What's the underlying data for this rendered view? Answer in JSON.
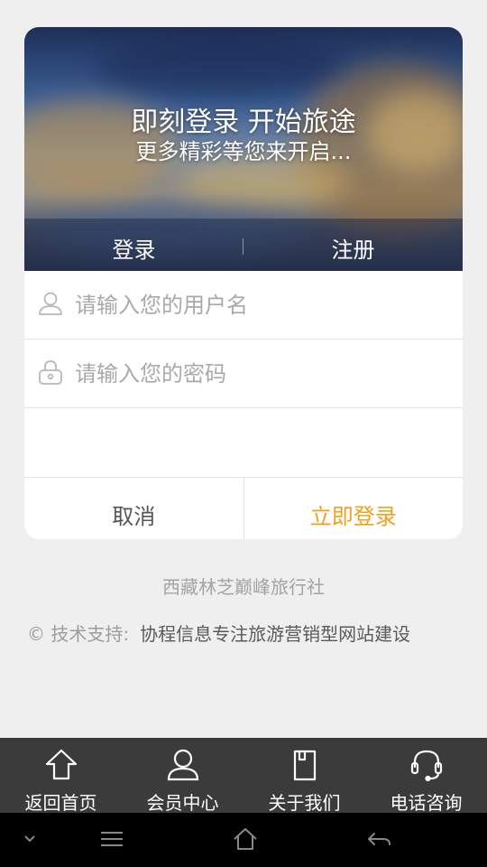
{
  "hero": {
    "title": "即刻登录 开始旅途",
    "subtitle": "更多精彩等您来开启..."
  },
  "tabs": {
    "login": "登录",
    "register": "注册"
  },
  "form": {
    "username_placeholder": "请输入您的用户名",
    "password_placeholder": "请输入您的密码",
    "username_value": "",
    "password_value": ""
  },
  "actions": {
    "cancel": "取消",
    "login": "立即登录"
  },
  "footer": {
    "agency": "西藏林芝巅峰旅行社",
    "support_prefix": "© 技术支持:",
    "support_link": "协程信息专注旅游营销型网站建设"
  },
  "bottom_nav": [
    {
      "label": "返回首页",
      "icon": "home-icon"
    },
    {
      "label": "会员中心",
      "icon": "user-icon"
    },
    {
      "label": "关于我们",
      "icon": "document-icon"
    },
    {
      "label": "电话咨询",
      "icon": "headset-icon"
    }
  ],
  "colors": {
    "accent": "#f0a11c",
    "nav_bg": "#3b3b3b",
    "page_bg": "#efefef"
  }
}
